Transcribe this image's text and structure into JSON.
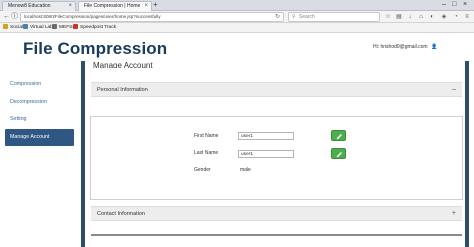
{
  "browser": {
    "tabs": [
      {
        "title": "Menow8 Education",
        "active": false
      },
      {
        "title": "File Compression | Home",
        "active": true
      }
    ],
    "url": "localhost:8080/FileCompression/pages/user/home.jsp?successfully",
    "search_placeholder": "Search",
    "bookmarks": [
      "Social",
      "Virtual Lab",
      "MEFSI",
      "Speedpost Track"
    ]
  },
  "header": {
    "app_title": "File Compression",
    "user_label": "Hi: hrishod9@gmail.com"
  },
  "sidebar": {
    "items": [
      {
        "label": "Compression",
        "active": false
      },
      {
        "label": "Decompression",
        "active": false
      },
      {
        "label": "Setting",
        "active": false
      },
      {
        "label": "Manage Account",
        "active": true
      }
    ]
  },
  "main": {
    "heading": "Manage Account",
    "personal_section": {
      "title": "Personal Information",
      "toggle": "–",
      "fields": {
        "first_name": {
          "label": "First Name",
          "value": "user1"
        },
        "last_name": {
          "label": "Last Name",
          "value": "user1"
        },
        "gender": {
          "label": "Gender",
          "value": "male"
        }
      }
    },
    "contact_section": {
      "title": "Contact Information",
      "toggle": "+"
    }
  },
  "colors": {
    "brand": "#1a3a5e",
    "sidebar_active": "#2e5783",
    "edit_button": "#4cae4c"
  }
}
